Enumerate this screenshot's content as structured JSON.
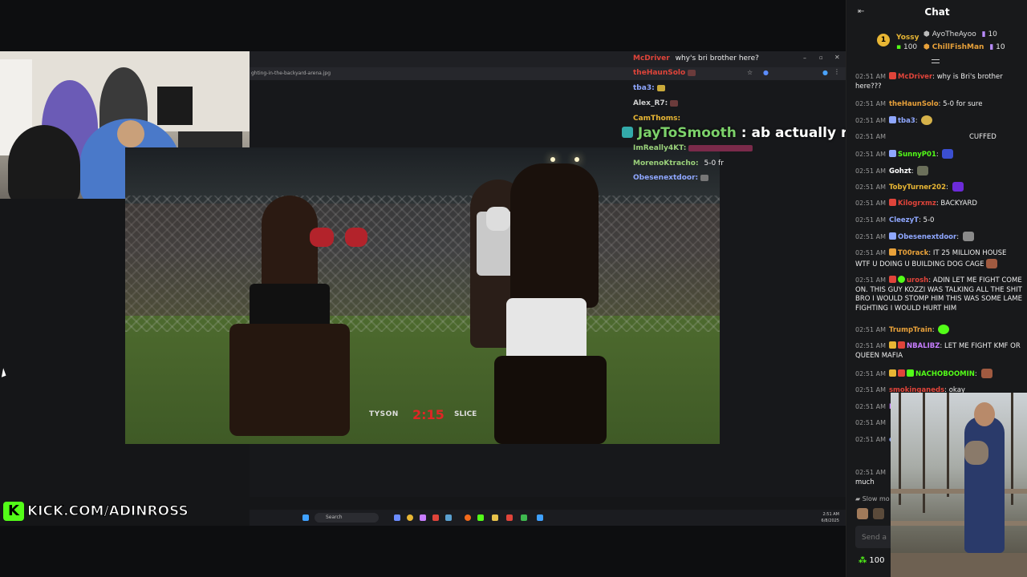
{
  "window": {
    "url_fragment": "ghting-in-the-backyard-arena.jpg"
  },
  "game_overlay": {
    "left_name": "TYSON",
    "clock": "2:15",
    "right_name": "SLICE"
  },
  "overlay_chat": [
    {
      "name": "McDriver",
      "msg": "why's bri brother here?"
    },
    {
      "name": "theHaunSolo",
      "msg": ""
    },
    {
      "name": "tba3:",
      "msg": ""
    },
    {
      "name": "Alex_R7:",
      "msg": ""
    },
    {
      "name": "CamThoms:",
      "msg": ""
    },
    {
      "name": "ImReally4KT:",
      "msg": ""
    },
    {
      "name": "MorenoKtracho:",
      "msg": "5-0 fr"
    },
    {
      "name": "Obesenextdoor:",
      "msg": ""
    }
  ],
  "big_message": {
    "name": "JayToSmooth",
    "separator": ":",
    "text": "ab actually ruined his shit perma"
  },
  "taskbar": {
    "search_placeholder": "Search",
    "time": "2:51 AM",
    "date": "6/8/2025"
  },
  "kick_badge": {
    "logo": "K",
    "text": "KICK.COM/ADINROSS"
  },
  "chat": {
    "title": "Chat",
    "leaderboard": [
      {
        "rank": "1",
        "name": "Yossy",
        "points": "100"
      },
      {
        "name": "AyoTheAyoo",
        "points": "10"
      },
      {
        "name": "ChillFishMan",
        "points": "10"
      }
    ],
    "messages": [
      {
        "time": "02:51 AM",
        "user": "McDriver",
        "color": "#e0443a",
        "text": "why is Bri's brother here???"
      },
      {
        "time": "02:51 AM",
        "user": "theHaunSolo",
        "color": "#e8a13a",
        "text": "5-0 for sure"
      },
      {
        "time": "02:51 AM",
        "user": "tba3",
        "color": "#8fa7ff",
        "text": ""
      },
      {
        "time": "02:51 AM",
        "user": "",
        "color": "#e8a13a",
        "text": "CUFFED"
      },
      {
        "time": "02:51 AM",
        "user": "SunnyP01",
        "color": "#53fc18",
        "text": ""
      },
      {
        "time": "02:51 AM",
        "user": "Gohzt",
        "color": "#ffffff",
        "text": ""
      },
      {
        "time": "02:51 AM",
        "user": "TobyTurner202",
        "color": "#e8b634",
        "text": ""
      },
      {
        "time": "02:51 AM",
        "user": "Kilogrxmz",
        "color": "#e0443a",
        "text": "BACKYARD"
      },
      {
        "time": "02:51 AM",
        "user": "CleezyT",
        "color": "#8fa7ff",
        "text": "5-0"
      },
      {
        "time": "02:51 AM",
        "user": "Obesenextdoor",
        "color": "#8fa7ff",
        "text": ""
      },
      {
        "time": "02:51 AM",
        "user": "T00rack",
        "color": "#e8a13a",
        "text": "IT 25 MILLION HOUSE WTF U DOING U BUILDING DOG CAGE"
      },
      {
        "time": "02:51 AM",
        "user": "urosh",
        "color": "#e0443a",
        "text": "ADIN LET ME FIGHT COME ON. THIS GUY KOZZI WAS TALKING ALL THE SHIT BRO I WOULD STOMP HIM THIS WAS SOME LAME FIGHTING I WOULD HURT HIM"
      },
      {
        "time": "02:51 AM",
        "user": "TrumpTrain",
        "color": "#e8a13a",
        "text": ""
      },
      {
        "time": "02:51 AM",
        "user": "NBALIBZ",
        "color": "#c77dff",
        "text": "LET ME FIGHT KMF OR QUEEN MAFIA"
      },
      {
        "time": "02:51 AM",
        "user": "NACHOBOOMIN",
        "color": "#53fc18",
        "text": ""
      },
      {
        "time": "02:51 AM",
        "user": "smokinganeds",
        "color": "#e0443a",
        "text": "okay"
      },
      {
        "time": "02:51 AM",
        "user": "M",
        "color": "#c77dff",
        "text": ""
      },
      {
        "time": "02:51 AM",
        "user": "",
        "color": "#ffffff",
        "text": ""
      },
      {
        "time": "02:51 AM",
        "user": "e",
        "color": "#8fa7ff",
        "text": ""
      },
      {
        "time": "02:51 AM",
        "user": "",
        "color": "#ffffff",
        "text": "much"
      }
    ],
    "slow_mode": "Slow mo",
    "input_placeholder": "Send a",
    "points": "100"
  }
}
